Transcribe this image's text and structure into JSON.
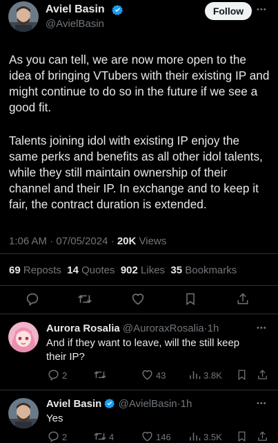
{
  "main_tweet": {
    "author_name": "Aviel Basin",
    "author_handle": "@AvielBasin",
    "follow_label": "Follow",
    "more": "•••",
    "paragraph1": "As you can tell, we are now more open to the idea of bringing VTubers with their existing IP and might continue to do so in the future if we see a good fit.",
    "paragraph2": "Talents joining idol with existing IP enjoy the same perks and benefits as all other idol talents, while they still maintain ownership of their channel and their IP. In exchange and to keep it fair, the contract duration is extended.",
    "time": "1:06 AM",
    "date": "07/05/2024",
    "views_count": "20K",
    "views_label": "Views",
    "stats": [
      {
        "num": "69",
        "label": "Reposts"
      },
      {
        "num": "14",
        "label": "Quotes"
      },
      {
        "num": "902",
        "label": "Likes"
      },
      {
        "num": "35",
        "label": "Bookmarks"
      }
    ],
    "actions": [
      "reply",
      "repost",
      "like",
      "bookmark",
      "share"
    ]
  },
  "replies": [
    {
      "author_name": "Aurora Rosalia",
      "author_handle": "@AuroraxRosalia",
      "time": "1h",
      "text": "And if they want to leave, will the still keep their IP?",
      "reply_count": "2",
      "repost_count": "",
      "like_count": "43",
      "view_count": "3.8K"
    },
    {
      "author_name": "Aviel Basin",
      "author_handle": "@AvielBasin",
      "time": "1h",
      "text": "Yes",
      "reply_count": "2",
      "repost_count": "4",
      "like_count": "146",
      "view_count": "3.5K"
    }
  ],
  "colors": {
    "background": "#000000",
    "text": "#e7e9ea",
    "muted": "#71767b",
    "verified": "#1d9bf0",
    "divider": "#2f3336"
  }
}
